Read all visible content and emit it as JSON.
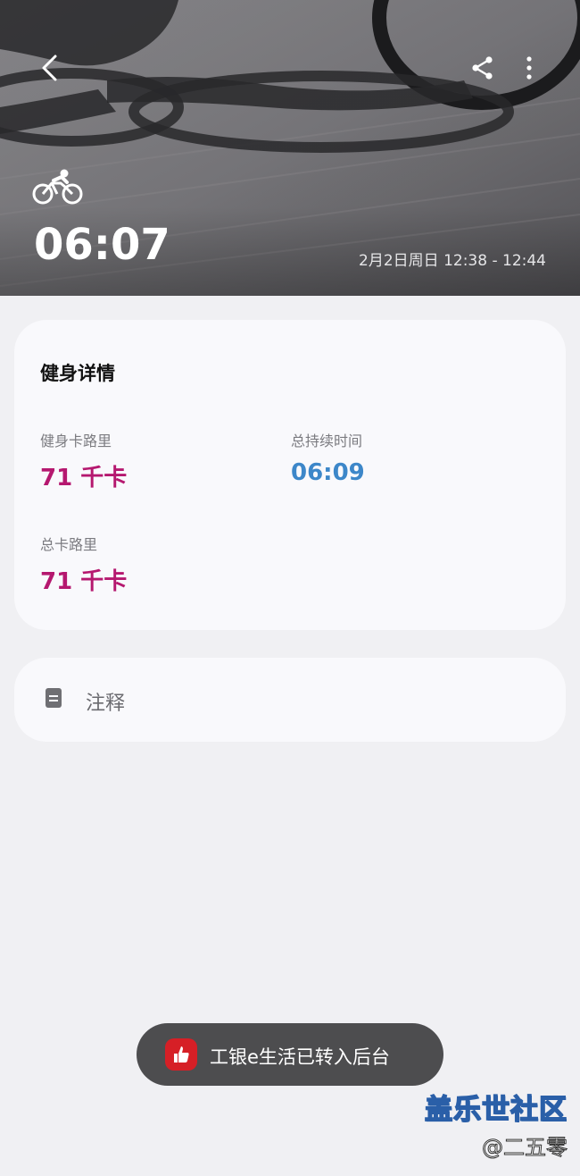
{
  "header": {
    "duration": "06:07",
    "time_range": "2月2日周日 12:38 - 12:44",
    "workout_icon": "cycling-icon",
    "back_icon": "chevron-left-icon",
    "share_icon": "share-icon",
    "more_icon": "more-vertical-icon"
  },
  "details": {
    "title": "健身详情",
    "stats": [
      {
        "label": "健身卡路里",
        "value": "71 千卡",
        "color": "#b5186f"
      },
      {
        "label": "总持续时间",
        "value": "06:09",
        "color": "#3d87c9"
      },
      {
        "label": "总卡路里",
        "value": "71 千卡",
        "color": "#b5186f"
      }
    ]
  },
  "notes": {
    "label": "注释",
    "icon": "note-icon"
  },
  "toast": {
    "text": "工银e生活已转入后台",
    "icon": "thumbs-up-icon",
    "icon_color": "#d61f26"
  },
  "watermark": {
    "title": "盖乐世社区",
    "user": "@二五零"
  }
}
